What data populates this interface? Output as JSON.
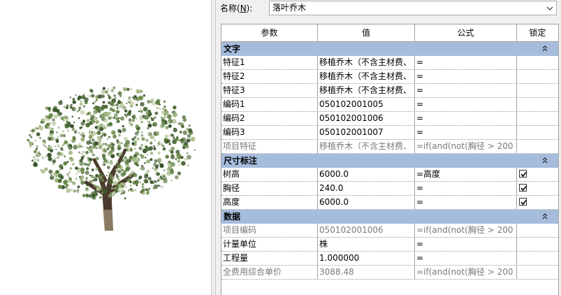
{
  "name_field": {
    "label": "名称(N):",
    "label_pre": "名称(",
    "label_key": "N",
    "label_post": "):",
    "value": "落叶乔木"
  },
  "columns": [
    "参数",
    "值",
    "公式",
    "锁定"
  ],
  "colors": {
    "group_bg": "#a6bcdc",
    "readonly_text": "#7a7a7a"
  },
  "groups": [
    {
      "title": "文字",
      "rows": [
        {
          "param": "特征1",
          "value": "移植乔木（不含主材费、",
          "formula": "=",
          "locked": null,
          "readonly": false
        },
        {
          "param": "特征2",
          "value": "移植乔木（不含主材费、",
          "formula": "=",
          "locked": null,
          "readonly": false
        },
        {
          "param": "特征3",
          "value": "移植乔木（不含主材费、",
          "formula": "=",
          "locked": null,
          "readonly": false
        },
        {
          "param": "编码1",
          "value": "050102001005",
          "formula": "=",
          "locked": null,
          "readonly": false
        },
        {
          "param": "编码2",
          "value": "050102001006",
          "formula": "=",
          "locked": null,
          "readonly": false
        },
        {
          "param": "编码3",
          "value": "050102001007",
          "formula": "=",
          "locked": null,
          "readonly": false
        },
        {
          "param": "项目特征",
          "value": "移植乔木（不含主材费、",
          "formula": "=if(and(not(胸径 > 200",
          "locked": null,
          "readonly": true
        }
      ]
    },
    {
      "title": "尺寸标注",
      "rows": [
        {
          "param": "树高",
          "value": "6000.0",
          "formula": "=高度",
          "locked": true,
          "readonly": false
        },
        {
          "param": "胸径",
          "value": "240.0",
          "formula": "=",
          "locked": true,
          "readonly": false
        },
        {
          "param": "高度",
          "value": "6000.0",
          "formula": "=",
          "locked": true,
          "readonly": false
        }
      ]
    },
    {
      "title": "数据",
      "rows": [
        {
          "param": "项目编码",
          "value": "050102001006",
          "formula": "=if(and(not(胸径 > 200",
          "locked": null,
          "readonly": true
        },
        {
          "param": "计量单位",
          "value": "株",
          "formula": "=",
          "locked": null,
          "readonly": false
        },
        {
          "param": "工程量",
          "value": "1.000000",
          "formula": "=",
          "locked": null,
          "readonly": false
        },
        {
          "param": "全费用综合单价",
          "value": "3088.48",
          "formula": "=if(and(not(胸径 > 200",
          "locked": null,
          "readonly": true
        }
      ]
    }
  ]
}
